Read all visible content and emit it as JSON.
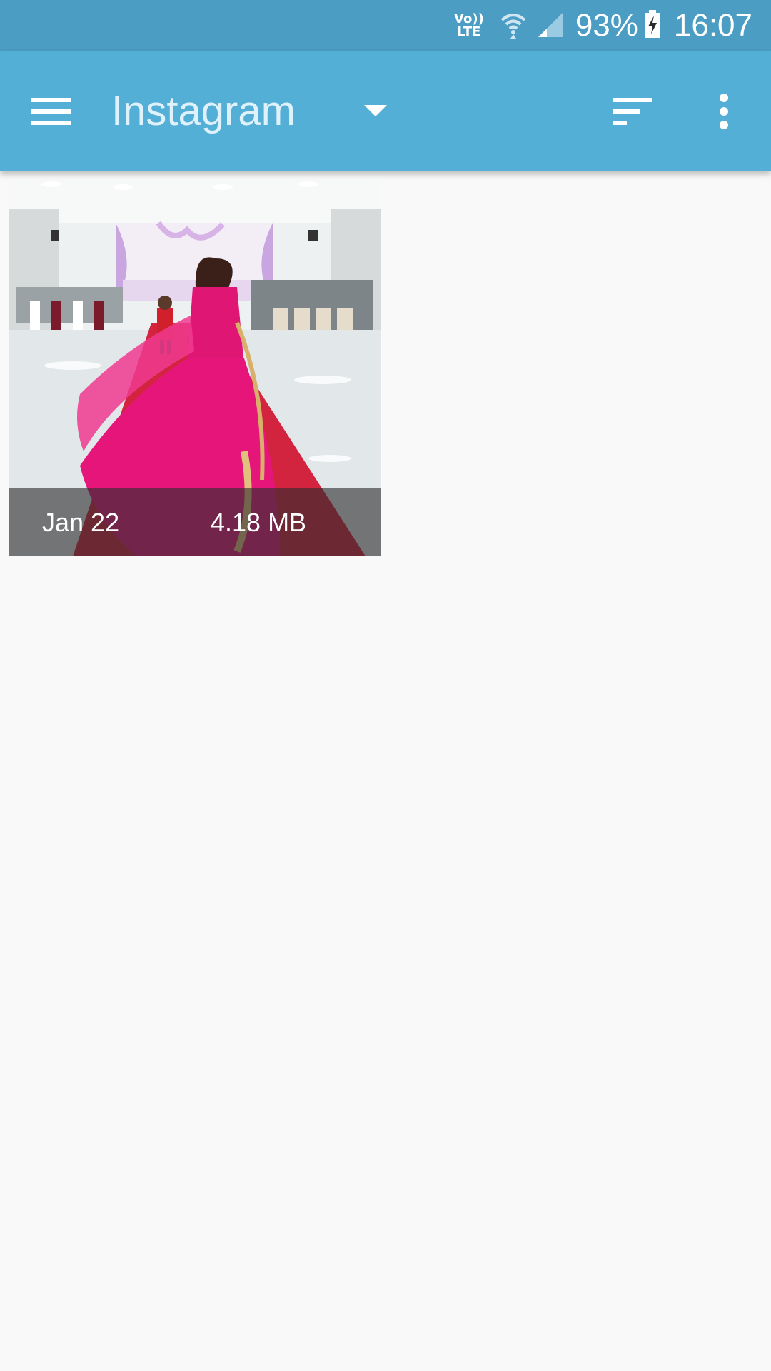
{
  "status_bar": {
    "network_label_top": "Vo))",
    "network_label_bottom": "LTE",
    "wifi_icon": "wifi-icon",
    "signal_icon": "signal-icon",
    "battery_percent": "93%",
    "battery_icon": "battery-charging-icon",
    "time": "16:07",
    "background_color": "#4b9dc4"
  },
  "app_bar": {
    "menu_icon": "hamburger-menu-icon",
    "title": "Instagram",
    "dropdown_icon": "caret-down-icon",
    "sort_icon": "sort-icon",
    "more_icon": "more-vertical-icon",
    "background_color": "#54afd6"
  },
  "gallery": {
    "items": [
      {
        "date": "Jan 22",
        "size": "4.18 MB",
        "thumbnail": "wedding-hall-video-thumbnail"
      }
    ]
  }
}
